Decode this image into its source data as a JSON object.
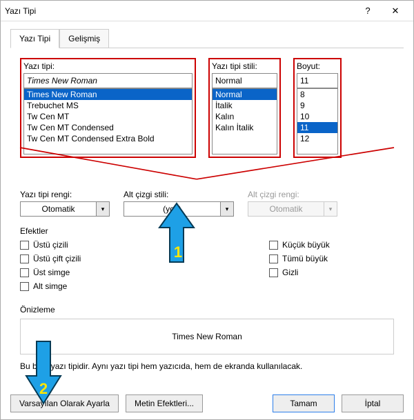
{
  "title": "Yazı Tipi",
  "tabs": {
    "font": "Yazı Tipi",
    "advanced": "Gelişmiş"
  },
  "fontGroup": {
    "label": "Yazı tipi:",
    "value": "Times New Roman",
    "items": [
      "Times New Roman",
      "Trebuchet MS",
      "Tw Cen MT",
      "Tw Cen MT Condensed",
      "Tw Cen MT Condensed Extra Bold"
    ],
    "selected": "Times New Roman"
  },
  "styleGroup": {
    "label": "Yazı tipi stili:",
    "value": "Normal",
    "items": [
      "Normal",
      "İtalik",
      "Kalın",
      "Kalın İtalik"
    ],
    "selected": "Normal"
  },
  "sizeGroup": {
    "label": "Boyut:",
    "value": "11",
    "items": [
      "8",
      "9",
      "10",
      "11",
      "12"
    ],
    "selected": "11"
  },
  "fontColor": {
    "label": "Yazı tipi rengi:",
    "value": "Otomatik"
  },
  "underlineStyle": {
    "label": "Alt çizgi stili:",
    "value": "(yok)"
  },
  "underlineColor": {
    "label": "Alt çizgi rengi:",
    "value": "Otomatik"
  },
  "effectsLabel": "Efektler",
  "effectsLeft": [
    "Üstü çizili",
    "Üstü çift çizili",
    "Üst simge",
    "Alt simge"
  ],
  "effectsRight": [
    "Küçük büyük",
    "Tümü büyük",
    "Gizli"
  ],
  "previewLabel": "Önizleme",
  "previewText": "Times New Roman",
  "note": "Bu bir  e yazı tipidir. Aynı yazı tipi hem yazıcıda, hem de ekranda kullanılacak.",
  "buttons": {
    "setDefault": "Varsayılan Olarak Ayarla",
    "textEffects": "Metin Efektleri...",
    "ok": "Tamam",
    "cancel": "İptal"
  },
  "annotations": {
    "one": "1",
    "two": "2"
  }
}
